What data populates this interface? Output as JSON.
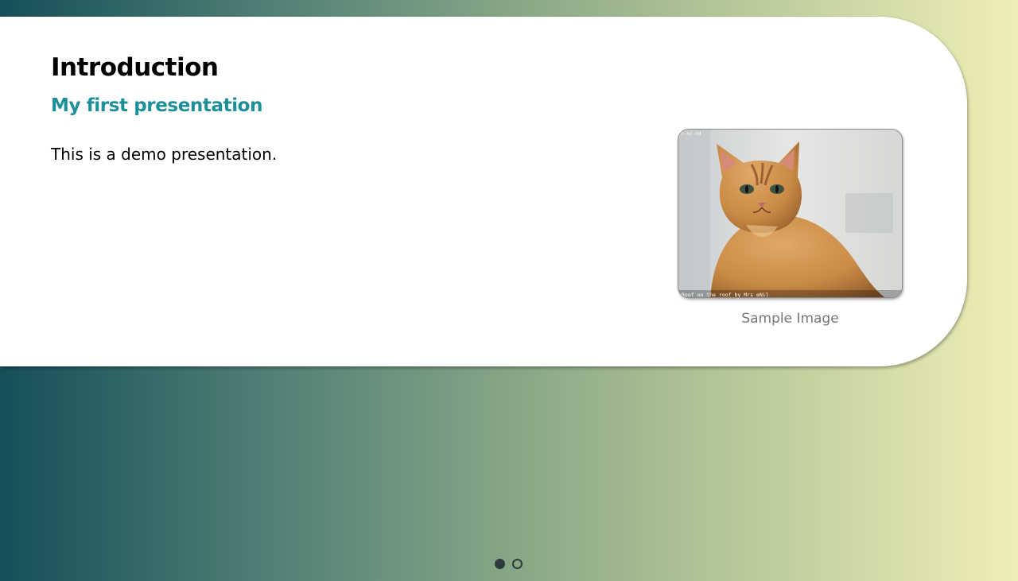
{
  "slide": {
    "title": "Introduction",
    "subtitle": "My first presentation",
    "body": "This is a demo presentation."
  },
  "figure": {
    "caption": "Sample Image",
    "image_subject": "orange tabby cat",
    "watermark_top": "c-nc-nd",
    "watermark_bottom": "Roof on the roof by Mrs eNil"
  },
  "pager": {
    "total": 2,
    "current": 1
  },
  "colors": {
    "subtitle": "#1d8f98",
    "gradient_start": "#164f58",
    "gradient_end": "#f0eeb6",
    "dot": "#2f3a3a"
  }
}
